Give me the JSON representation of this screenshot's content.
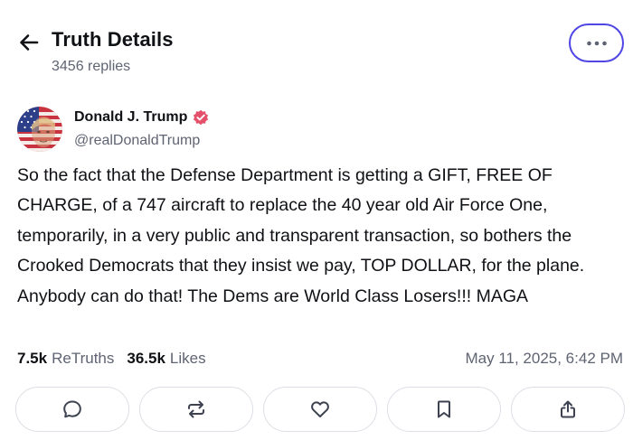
{
  "header": {
    "title": "Truth Details",
    "replies": "3456 replies"
  },
  "post": {
    "author": {
      "display_name": "Donald J. Trump",
      "handle": "@realDonaldTrump",
      "verified": true
    },
    "text": "So the fact that the Defense Department is getting a GIFT, FREE OF CHARGE, of a 747 aircraft to replace the 40 year old Air Force One, temporarily, in a very public and transparent transaction, so bothers the Crooked Democrats that they insist we pay, TOP DOLLAR, for the plane. Anybody can do that! The Dems are World Class Losers!!! MAGA",
    "stats": {
      "retruths_count": "7.5k",
      "retruths_label": "ReTruths",
      "likes_count": "36.5k",
      "likes_label": "Likes"
    },
    "timestamp": "May 11, 2025, 6:42 PM"
  },
  "actions": [
    {
      "name": "reply",
      "icon": "speech-bubble-icon"
    },
    {
      "name": "retruth",
      "icon": "repost-arrows-icon"
    },
    {
      "name": "like",
      "icon": "heart-icon"
    },
    {
      "name": "bookmark",
      "icon": "bookmark-icon"
    },
    {
      "name": "share",
      "icon": "share-upload-icon"
    }
  ],
  "colors": {
    "accent": "#4f46e5",
    "verified_badge": "#e4506a",
    "text_primary": "#0f1115",
    "text_secondary": "#5f6472",
    "border": "#dcdfe5"
  }
}
